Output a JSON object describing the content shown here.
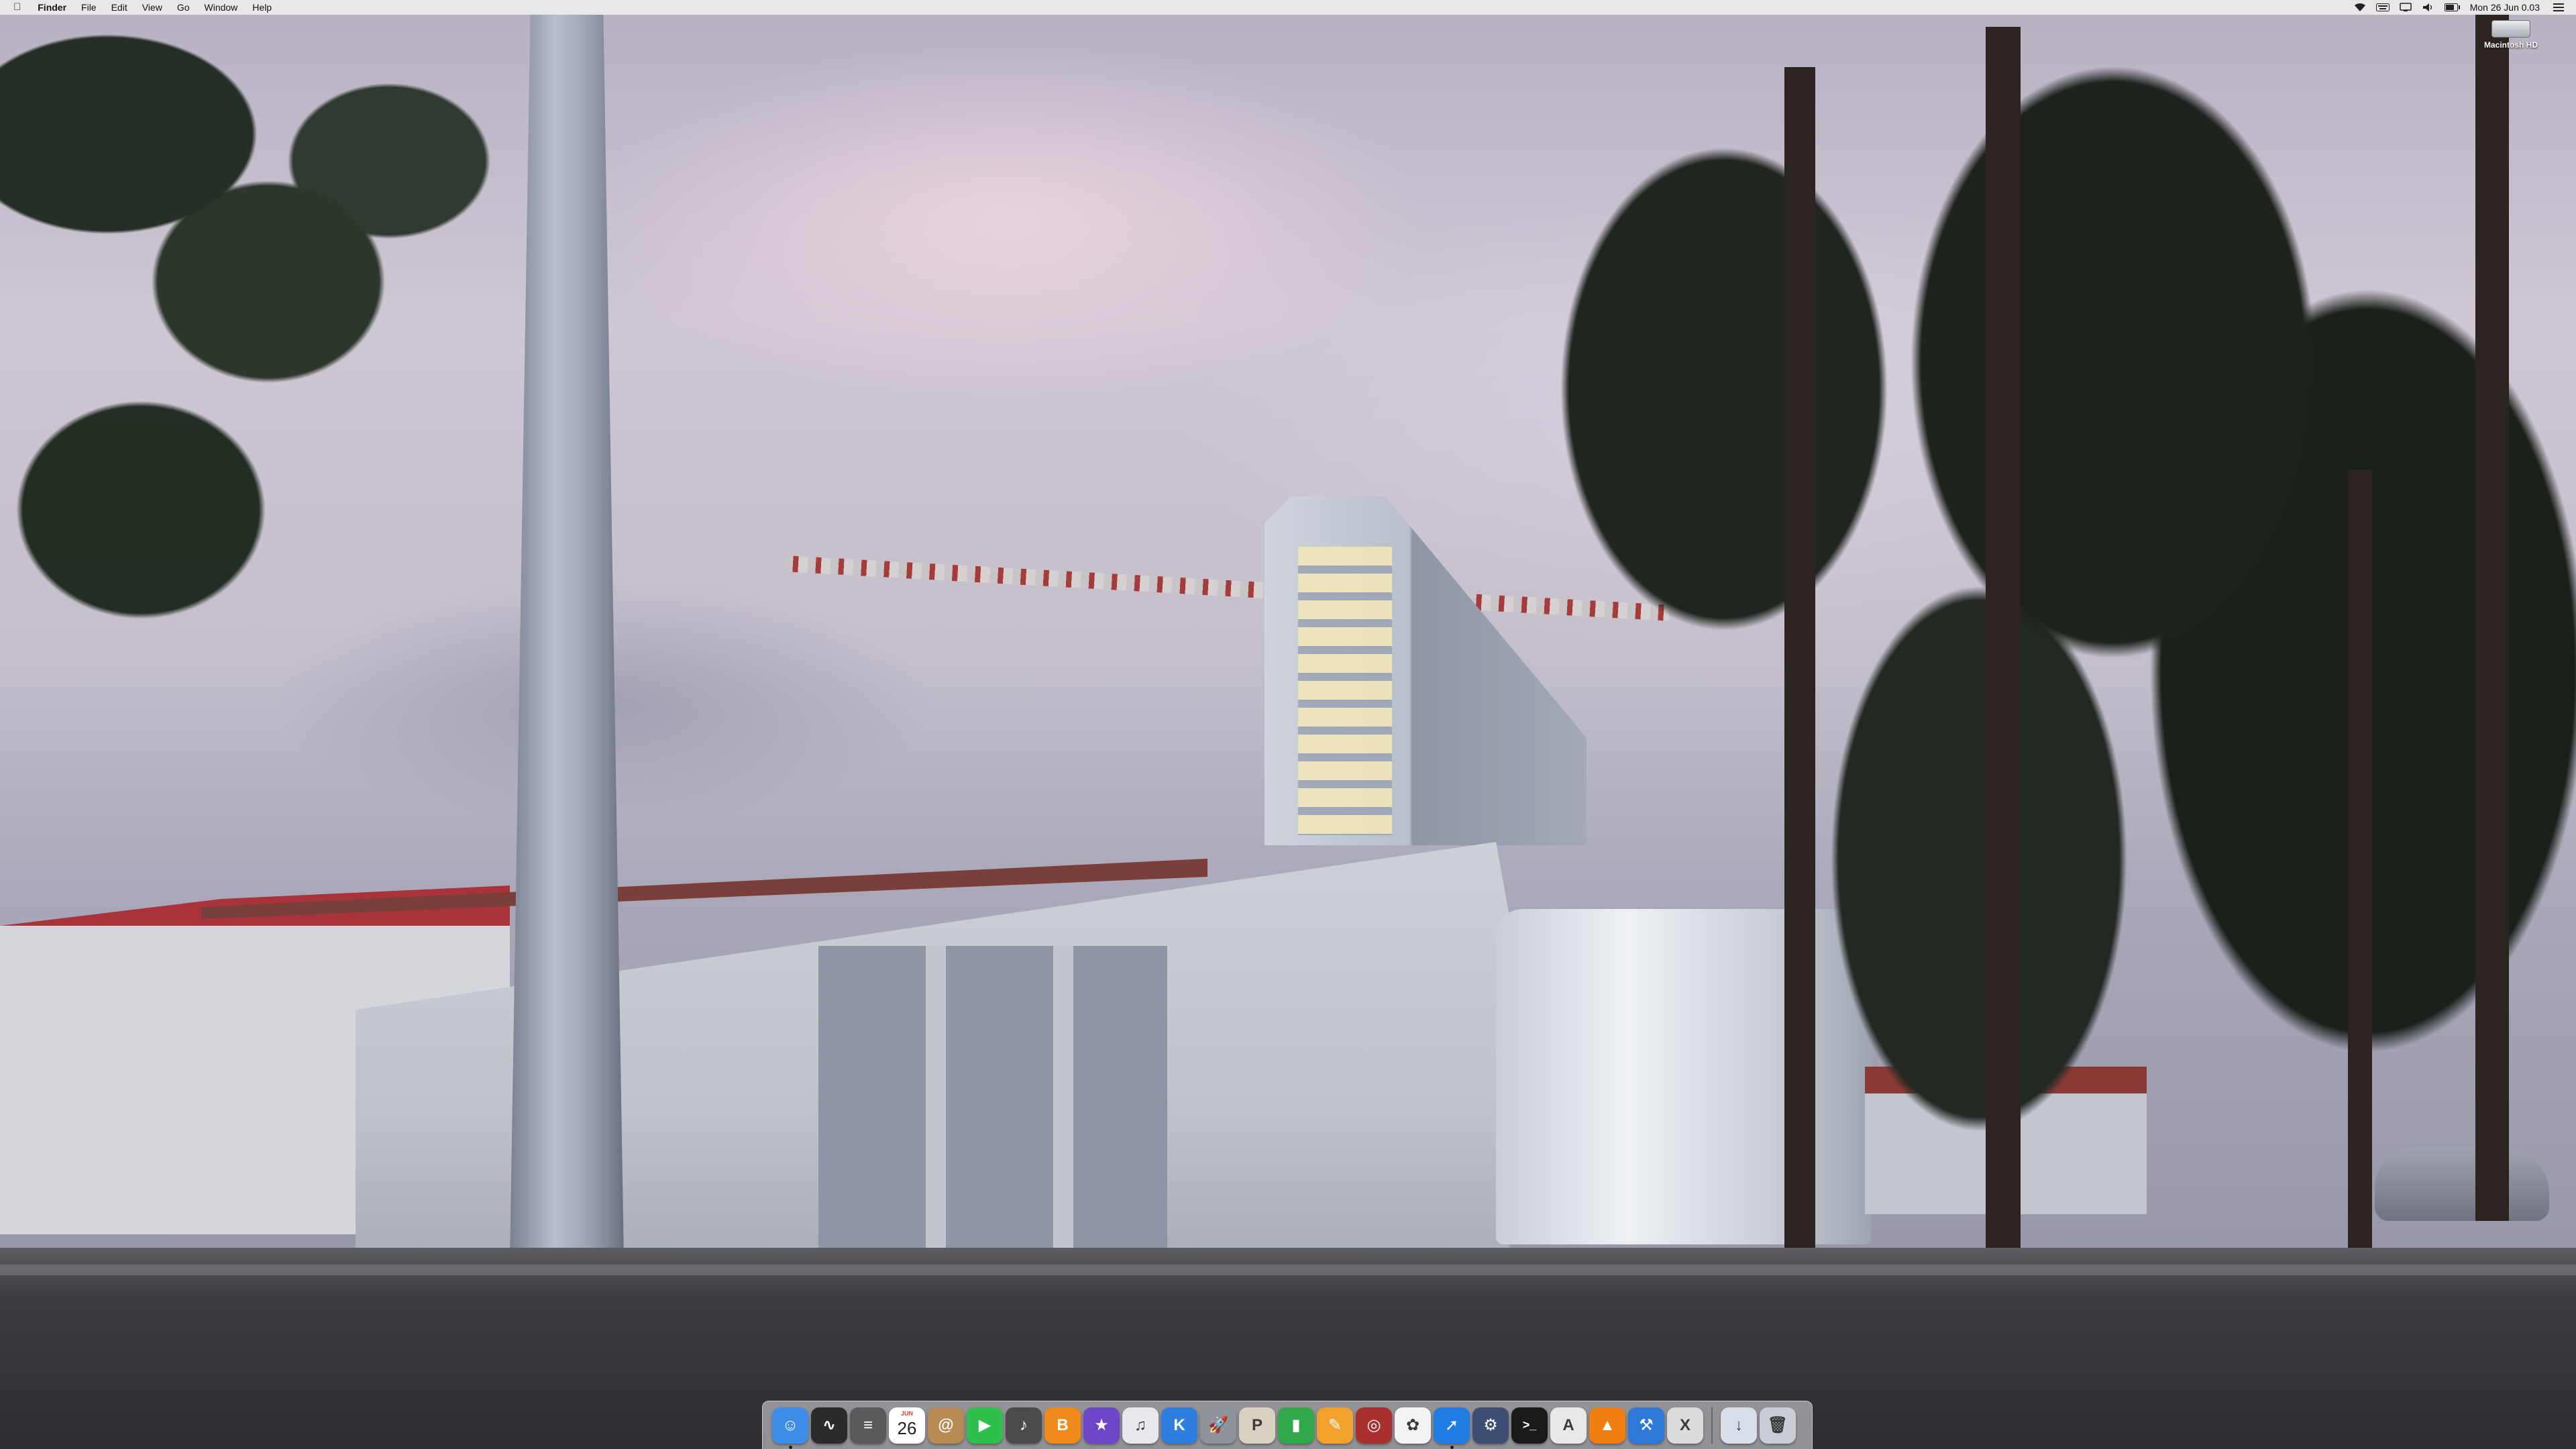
{
  "menubar": {
    "apple_icon": "apple-icon",
    "app_name": "Finder",
    "menus": [
      "File",
      "Edit",
      "View",
      "Go",
      "Window",
      "Help"
    ],
    "status_icons": [
      "wifi-icon",
      "keyboard-icon",
      "display-icon",
      "volume-icon",
      "battery-icon",
      "notification-center-icon"
    ],
    "clock": "Mon 26 Jun 0.03"
  },
  "desktop": {
    "drive_label": "Macintosh HD",
    "drive_icon": "hard-drive-icon"
  },
  "dock": {
    "apps": [
      {
        "name": "Finder",
        "icon": "finder-icon",
        "color": "#3d8ee8",
        "running": true
      },
      {
        "name": "Activity Monitor",
        "icon": "activity-monitor-icon",
        "color": "#2b2b2b"
      },
      {
        "name": "Notes",
        "icon": "notes-icon",
        "color": "#5a5a5a"
      },
      {
        "name": "Calendar",
        "icon": "calendar-icon",
        "color": "#ffffff",
        "month": "JUN",
        "day": "26"
      },
      {
        "name": "Contacts",
        "icon": "contacts-icon",
        "color": "#b58a53"
      },
      {
        "name": "FaceTime",
        "icon": "facetime-icon",
        "color": "#2fbf4b"
      },
      {
        "name": "GarageBand",
        "icon": "garageband-icon",
        "color": "#4b4b4b"
      },
      {
        "name": "iBooks",
        "icon": "ibooks-icon",
        "color": "#f08a1c"
      },
      {
        "name": "iMovie",
        "icon": "imovie-icon",
        "color": "#7046c9"
      },
      {
        "name": "iTunes",
        "icon": "itunes-icon",
        "color": "#e7e7ee"
      },
      {
        "name": "Keynote",
        "icon": "keynote-icon",
        "color": "#2f7fe0"
      },
      {
        "name": "Launchpad",
        "icon": "launchpad-icon",
        "color": "#8e9299"
      },
      {
        "name": "Preview",
        "icon": "preview-icon",
        "color": "#d9d2c0"
      },
      {
        "name": "Numbers",
        "icon": "numbers-icon",
        "color": "#31a94a"
      },
      {
        "name": "Pages",
        "icon": "pages-icon",
        "color": "#f2a12c"
      },
      {
        "name": "Photo Booth",
        "icon": "photo-booth-icon",
        "color": "#a9302e"
      },
      {
        "name": "Photos",
        "icon": "photos-icon",
        "color": "#f3f3f3"
      },
      {
        "name": "Safari",
        "icon": "safari-icon",
        "color": "#1f7de3",
        "running": true
      },
      {
        "name": "System Preferences",
        "icon": "system-preferences-icon",
        "color": "#3c4f72"
      },
      {
        "name": "Terminal",
        "icon": "terminal-icon",
        "color": "#1a1a1a"
      },
      {
        "name": "TextEdit",
        "icon": "textedit-icon",
        "color": "#e8e8e8"
      },
      {
        "name": "VLC",
        "icon": "vlc-icon",
        "color": "#f07d10"
      },
      {
        "name": "Xcode",
        "icon": "xcode-icon",
        "color": "#2f7ad8"
      },
      {
        "name": "X11",
        "icon": "x11-icon",
        "color": "#dcdcdc"
      }
    ],
    "trailing": [
      {
        "name": "Downloads",
        "icon": "downloads-stack-icon",
        "color": "#d9dfe8"
      },
      {
        "name": "Trash",
        "icon": "trash-icon",
        "color": "#c9ced6"
      }
    ]
  }
}
